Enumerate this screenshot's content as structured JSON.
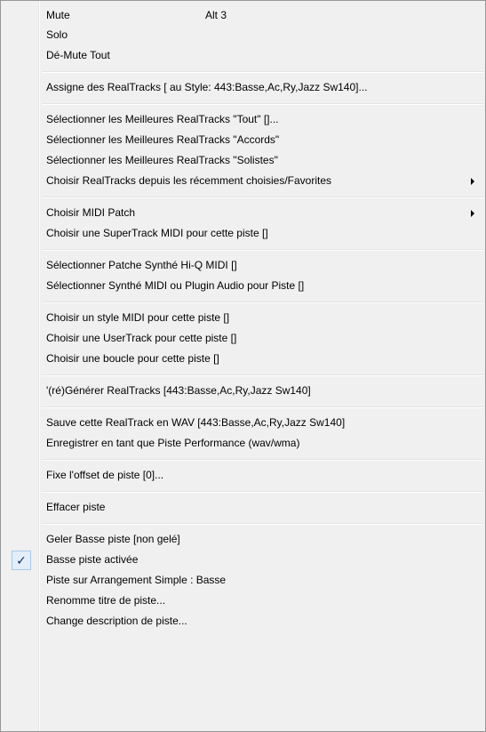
{
  "menu": {
    "items": [
      {
        "label": "Mute",
        "shortcut": "Alt 3"
      },
      {
        "label": "Solo"
      },
      {
        "label": "Dé-Mute Tout"
      },
      {
        "label": "Assigne des RealTracks [ au Style: 443:Basse,Ac,Ry,Jazz Sw140]..."
      },
      {
        "label": "Sélectionner les Meilleures RealTracks \"Tout\" []..."
      },
      {
        "label": "Sélectionner les Meilleures RealTracks \"Accords\""
      },
      {
        "label": "Sélectionner les Meilleures RealTracks \"Solistes\""
      },
      {
        "label": "Choisir RealTracks depuis les récemment choisies/Favorites",
        "submenu": true
      },
      {
        "label": "Choisir MIDI Patch",
        "submenu": true
      },
      {
        "label": "Choisir une SuperTrack MIDI pour cette piste  []"
      },
      {
        "label": "Sélectionner Patche Synthé Hi-Q MIDI []"
      },
      {
        "label": "Sélectionner Synthé MIDI  ou Plugin Audio pour Piste []"
      },
      {
        "label": "Choisir un style MIDI pour cette piste  []"
      },
      {
        "label": "Choisir une UserTrack pour cette piste  []"
      },
      {
        "label": "Choisir une boucle pour cette piste  []"
      },
      {
        "label": "'(ré)Générer RealTracks [443:Basse,Ac,Ry,Jazz Sw140]"
      },
      {
        "label": "Sauve cette RealTrack en WAV [443:Basse,Ac,Ry,Jazz Sw140]"
      },
      {
        "label": "Enregistrer en tant que Piste Performance (wav/wma)"
      },
      {
        "label": "Fixe l'offset de piste [0]..."
      },
      {
        "label": "Effacer piste"
      },
      {
        "label": "Geler Basse piste   [non gelé]"
      },
      {
        "label": "Basse piste activée",
        "checked": true,
        "check_glyph": "✓"
      },
      {
        "label": "Piste sur Arrangement Simple : Basse"
      },
      {
        "label": "Renomme titre de piste..."
      },
      {
        "label": "Change description de piste..."
      }
    ]
  },
  "colors": {
    "menu_bg": "#f0f0f0",
    "border": "#979797",
    "separator": "#e2e3e3",
    "check_bg": "#e3eef9",
    "check_border": "#a8c8ea",
    "check_mark": "#0a2a6a"
  }
}
